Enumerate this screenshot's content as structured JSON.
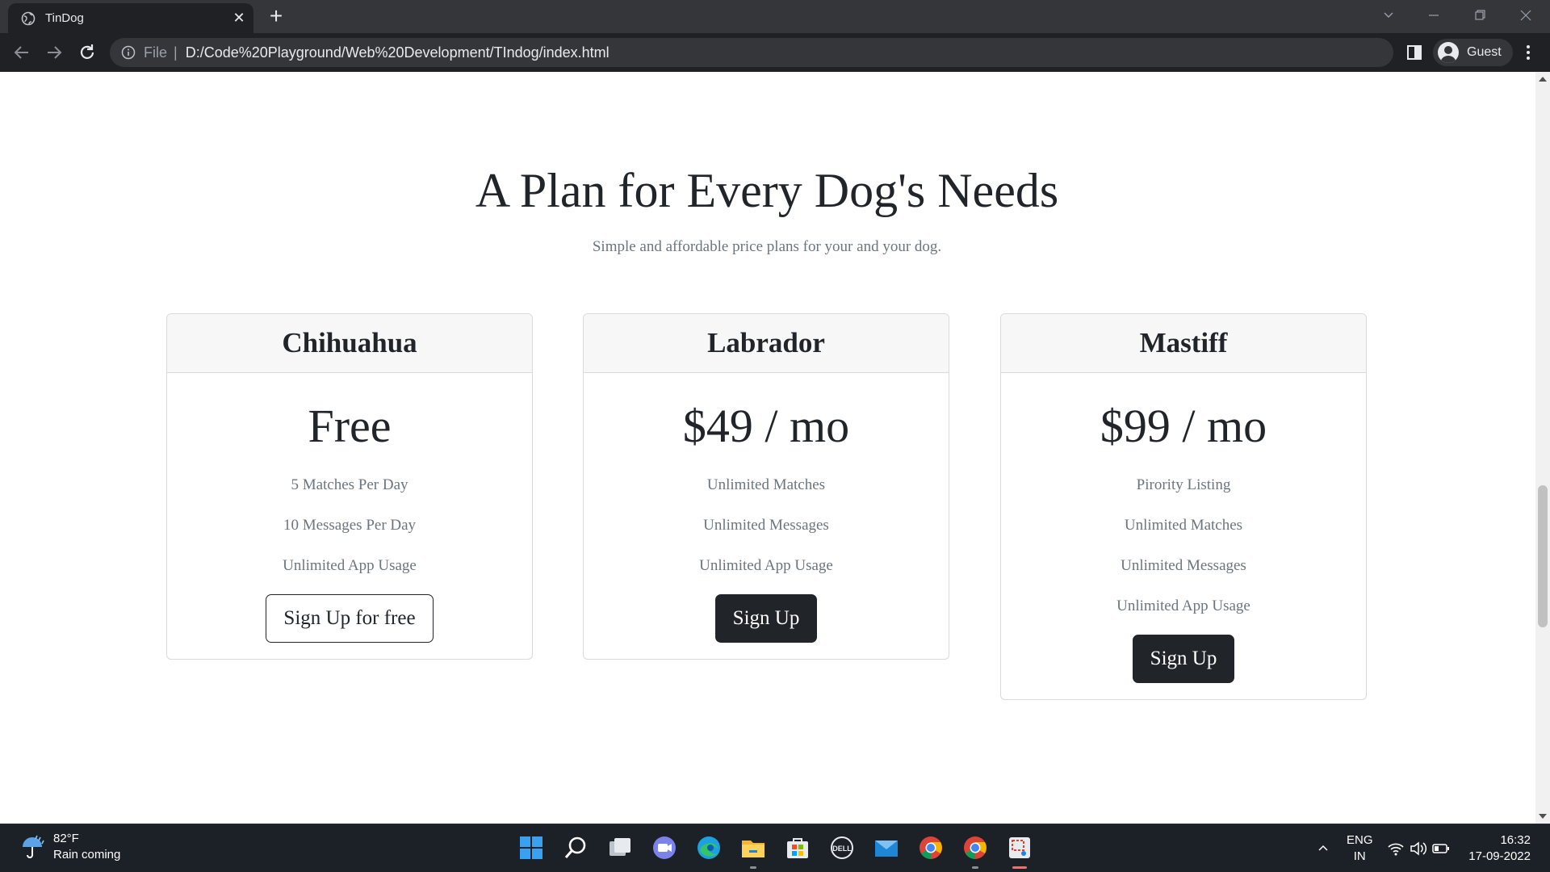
{
  "browser": {
    "tab_title": "TinDog",
    "new_tab_label": "+",
    "url_scheme_label": "File",
    "url": "D:/Code%20Playground/Web%20Development/TIndog/index.html",
    "profile_name": "Guest"
  },
  "pricing": {
    "title": "A Plan for Every Dog's Needs",
    "subtitle": "Simple and affordable price plans for your and your dog.",
    "plans": [
      {
        "name": "Chihuahua",
        "price": "Free",
        "features": [
          "5 Matches Per Day",
          "10 Messages Per Day",
          "Unlimited App Usage"
        ],
        "button_label": "Sign Up for free"
      },
      {
        "name": "Labrador",
        "price": "$49 / mo",
        "features": [
          "Unlimited Matches",
          "Unlimited Messages",
          "Unlimited App Usage"
        ],
        "button_label": "Sign Up"
      },
      {
        "name": "Mastiff",
        "price": "$99 / mo",
        "features": [
          "Pirority Listing",
          "Unlimited Matches",
          "Unlimited Messages",
          "Unlimited App Usage"
        ],
        "button_label": "Sign Up"
      }
    ]
  },
  "taskbar": {
    "weather_temp": "82°F",
    "weather_desc": "Rain coming",
    "lang_line1": "ENG",
    "lang_line2": "IN",
    "time": "16:32",
    "date": "17-09-2022",
    "apps": [
      "start-icon",
      "search-icon",
      "task-view-icon",
      "teams-chat-icon",
      "edge-icon",
      "file-explorer-icon",
      "store-icon",
      "dell-icon",
      "mail-icon",
      "chrome-icon",
      "chrome-icon",
      "snipping-tool-icon"
    ]
  },
  "colors": {
    "page_text": "#212529",
    "muted_text": "#6c757d",
    "button_dark": "#212529",
    "card_header_bg": "#f7f7f7",
    "browser_frame": "#202124",
    "taskbar_bg": "#1c2127"
  }
}
